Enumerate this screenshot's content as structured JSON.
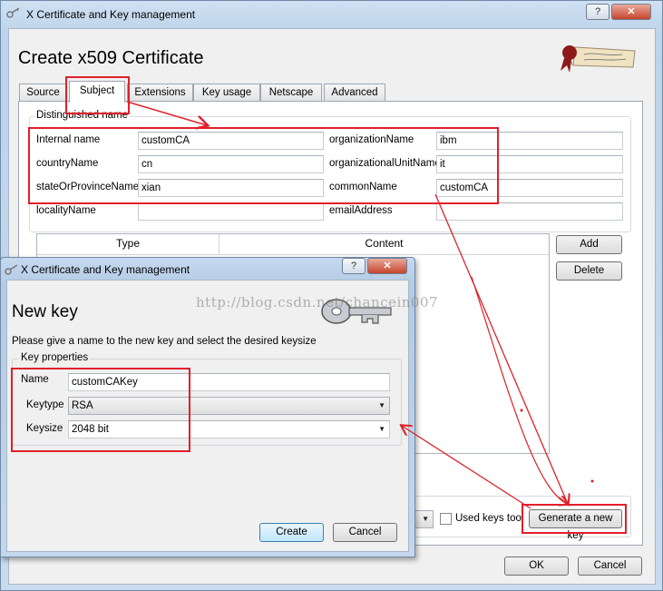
{
  "main_window": {
    "title": "X Certificate and Key management",
    "heading": "Create x509 Certificate",
    "tabs": [
      "Source",
      "Subject",
      "Extensions",
      "Key usage",
      "Netscape",
      "Advanced"
    ],
    "active_tab": "Subject",
    "distinguished_name": {
      "group_title": "Distinguished name",
      "internal_name_label": "Internal name",
      "internal_name_value": "customCA",
      "country_label": "countryName",
      "country_value": "cn",
      "state_label": "stateOrProvinceName",
      "state_value": "xian",
      "locality_label": "localityName",
      "locality_value": "",
      "org_label": "organizationName",
      "org_value": "ibm",
      "org_unit_label": "organizationalUnitName",
      "org_unit_value": "it",
      "common_name_label": "commonName",
      "common_name_value": "customCA",
      "email_label": "emailAddress",
      "email_value": ""
    },
    "table_headers": [
      "Type",
      "Content"
    ],
    "add_label": "Add",
    "delete_label": "Delete",
    "used_keys_label": "Used keys too",
    "generate_key_label": "Generate a new key",
    "ok_label": "OK",
    "cancel_label": "Cancel"
  },
  "dialog": {
    "title": "X Certificate and Key management",
    "heading": "New key",
    "description": "Please give a name to the new key and select the desired keysize",
    "group_title": "Key properties",
    "name_label": "Name",
    "name_value": "customCAKey",
    "keytype_label": "Keytype",
    "keytype_value": "RSA",
    "keysize_label": "Keysize",
    "keysize_value": "2048 bit",
    "create_label": "Create",
    "cancel_label": "Cancel"
  },
  "watermark": "http://blog.csdn.net/chancein007",
  "colors": {
    "annotation_red": "#e0202a",
    "client_bg": "#f0f0f0",
    "title_bar": "#c9dbee"
  },
  "icons": [
    "key-icon",
    "logo-icon",
    "large-key-icon"
  ]
}
